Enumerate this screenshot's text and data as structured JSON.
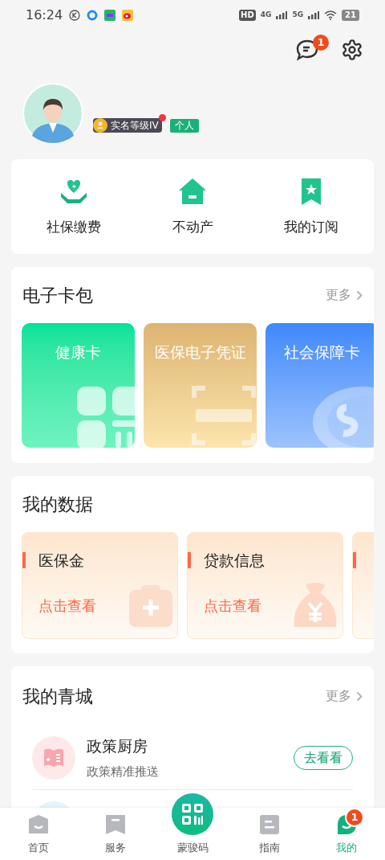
{
  "status_bar": {
    "time": "16:24",
    "hd": "HD",
    "network_1": "4G",
    "network_2": "5G",
    "battery": "21"
  },
  "header": {
    "message_badge": "1"
  },
  "profile": {
    "level_badge": "实名等级IV",
    "level_badge_dot": true,
    "type_tag": "个人"
  },
  "shortcuts": [
    {
      "label": "社保缴费",
      "kind": "heart"
    },
    {
      "label": "不动产",
      "kind": "house"
    },
    {
      "label": "我的订阅",
      "kind": "bookmark"
    }
  ],
  "wallet": {
    "title": "电子卡包",
    "more": "更多",
    "cards": [
      {
        "title": "健康卡",
        "kind": "health"
      },
      {
        "title": "医保电子凭证",
        "kind": "medical"
      },
      {
        "title": "社会保障卡",
        "kind": "social"
      }
    ]
  },
  "my_data": {
    "title": "我的数据",
    "cards": [
      {
        "title": "医保金",
        "link": "点击查看",
        "kind": "medical"
      },
      {
        "title": "贷款信息",
        "link": "点击查看",
        "kind": "loan"
      }
    ]
  },
  "my_city": {
    "title": "我的青城",
    "more": "更多",
    "items": [
      {
        "title": "政策厨房",
        "subtitle": "政策精准推送",
        "action": "去看看"
      }
    ]
  },
  "nav": {
    "items": [
      {
        "label": "首页",
        "kind": "home",
        "selected": false
      },
      {
        "label": "服务",
        "kind": "service",
        "selected": false
      },
      {
        "label": "蒙骏码",
        "kind": "center",
        "selected": false
      },
      {
        "label": "指南",
        "kind": "guide",
        "selected": false
      },
      {
        "label": "我的",
        "kind": "mine",
        "selected": true,
        "badge": "1"
      }
    ]
  }
}
